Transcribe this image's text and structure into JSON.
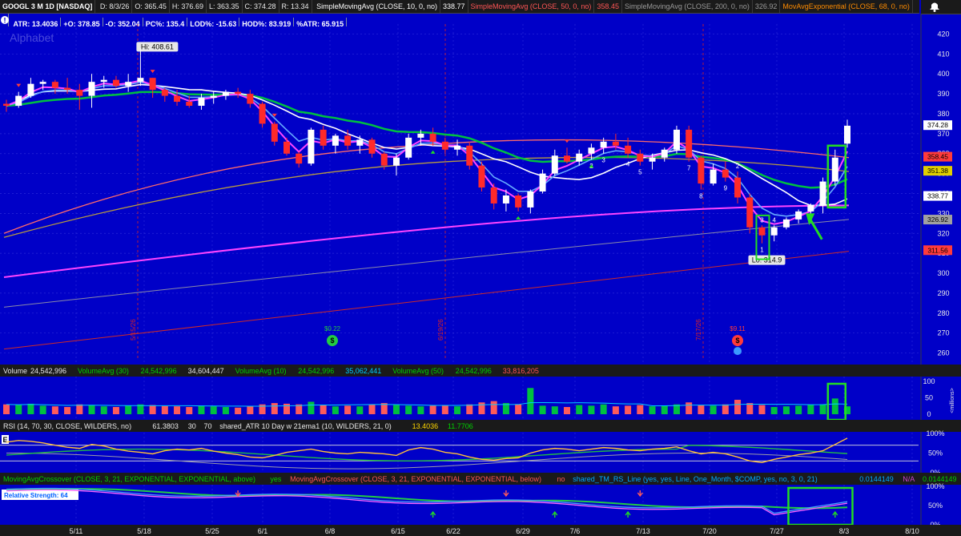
{
  "header": {
    "symbol": "GOOGL 3 M 1D [NASDAQ]",
    "ohlc": [
      {
        "label": "D: 8/3/26",
        "color": "#e8e8e8"
      },
      {
        "label": "O: 365.45",
        "color": "#e8e8e8"
      },
      {
        "label": "H: 376.69",
        "color": "#e8e8e8"
      },
      {
        "label": "L: 363.35",
        "color": "#e8e8e8"
      },
      {
        "label": "C: 374.28",
        "color": "#e8e8e8"
      },
      {
        "label": "R: 13.34",
        "color": "#e8e8e8"
      }
    ],
    "studies": [
      {
        "label": "SimpleMovingAvg (CLOSE, 10, 0, no)",
        "value": "338.77",
        "color": "#ffffff"
      },
      {
        "label": "SimpleMovingAvg (CLOSE, 50, 0, no)",
        "value": "358.45",
        "color": "#ff5555"
      },
      {
        "label": "SimpleMovingAvg (CLOSE, 200, 0, no)",
        "value": "326.92",
        "color": "#9a9a9a"
      },
      {
        "label": "MovAvgExponential (CLOSE, 68, 0, no)",
        "value": "",
        "color": "#ff8c00"
      }
    ],
    "info_icon": "!",
    "stats": [
      "ATR: 13.4036",
      "+O: 378.85",
      "-O: 352.04",
      "PC%: 135.4",
      "LOD%: -15.63",
      "HOD%: 83.919",
      "%ATR: 65.915"
    ],
    "watermark": "Alphabet",
    "bell_icon": "bell-icon"
  },
  "price_axis": {
    "ticks": [
      420,
      410,
      400,
      390,
      380,
      370,
      360,
      350,
      340,
      330,
      320,
      310,
      300,
      290,
      280,
      270,
      260
    ],
    "markers": [
      {
        "value": "374.28",
        "price": 374.28,
        "bg": "#ffffff",
        "fg": "#000000"
      },
      {
        "value": "358.45",
        "price": 358.45,
        "bg": "#ff3b3b",
        "fg": "#000000"
      },
      {
        "value": "351.38",
        "price": 351.38,
        "bg": "#e0d000",
        "fg": "#000000"
      },
      {
        "value": "338.77",
        "price": 338.77,
        "bg": "#ffffff",
        "fg": "#000000"
      },
      {
        "value": "326.92",
        "price": 326.92,
        "bg": "#a0a0a0",
        "fg": "#000000"
      },
      {
        "value": "311.56",
        "price": 311.56,
        "bg": "#ff3b3b",
        "fg": "#000000"
      }
    ]
  },
  "annotations": {
    "hi": "Hi: 408.61",
    "lo": "Lo: 314.9",
    "div1_value": "$0.22",
    "div2_value": "$9.11",
    "earnings_date_1": "5/15/26",
    "earnings_date_2": "6/19/26",
    "earnings_date_3": "7/17/26",
    "counts": [
      {
        "t": "1",
        "i": 62
      },
      {
        "t": "2",
        "i": 48
      },
      {
        "t": "3",
        "i": 49
      },
      {
        "t": "4",
        "i": 51
      },
      {
        "t": "5",
        "i": 52
      },
      {
        "t": "7",
        "i": 56
      },
      {
        "t": "8",
        "i": 57
      },
      {
        "t": "9",
        "i": 59
      },
      {
        "t": "2",
        "i": 60
      },
      {
        "t": "3",
        "i": 62
      },
      {
        "t": "4",
        "i": 63
      }
    ]
  },
  "volume_bar": {
    "title": "Volume",
    "items": [
      {
        "label": "24,542,996",
        "color": "#e8e8e8"
      },
      {
        "label": "VolumeAvg (30)",
        "color": "#00d000"
      },
      {
        "label": "24,542,996",
        "color": "#00d000"
      },
      {
        "label": "34,604,447",
        "color": "#e8e8e8"
      },
      {
        "label": "VolumeAvg (10)",
        "color": "#00d000"
      },
      {
        "label": "24,542,996",
        "color": "#00d000"
      },
      {
        "label": "35,062,441",
        "color": "#00ccff"
      },
      {
        "label": "VolumeAvg (50)",
        "color": "#00d000"
      },
      {
        "label": "24,542,996",
        "color": "#00d000"
      },
      {
        "label": "33,816,205",
        "color": "#ff5555"
      }
    ],
    "ticks": [
      "100",
      "50",
      "0"
    ],
    "units": "<millions>"
  },
  "rsi_bar": {
    "items": [
      {
        "label": "RSI (14, 70, 30, CLOSE, WILDERS, no)",
        "color": "#e8e8e8"
      },
      {
        "label": "61.3803",
        "color": "#e8e8e8"
      },
      {
        "label": "30",
        "color": "#e8e8e8"
      },
      {
        "label": "70",
        "color": "#e8e8e8"
      },
      {
        "label": "shared_ATR 10 Day w 21ema1 (10, WILDERS, 21, 0)",
        "color": "#e8e8e8"
      },
      {
        "label": "13.4036",
        "color": "#ffd700"
      },
      {
        "label": "11.7706",
        "color": "#00d000"
      }
    ],
    "badge": "E",
    "ticks": [
      "100%",
      "50%",
      "0%"
    ]
  },
  "rs_bar": {
    "items": [
      {
        "label": "MovingAvgCrossover (CLOSE, 3, 21, EXPONENTIAL, EXPONENTIAL, above)",
        "color": "#00d000"
      },
      {
        "label": "yes",
        "color": "#00d000"
      },
      {
        "label": "MovingAvgCrossover (CLOSE, 3, 21, EXPONENTIAL, EXPONENTIAL, below)",
        "color": "#ff5555"
      },
      {
        "label": "no",
        "color": "#ff5555"
      },
      {
        "label": "shared_TM_RS_Line (yes, yes, Line, One_Month, $COMP, yes, no, 3, 0, 21)",
        "color": "#00aaff"
      },
      {
        "label": "0.0144149",
        "color": "#00aaff"
      },
      {
        "label": "N/A",
        "color": "#cc44cc"
      },
      {
        "label": "0.0144149",
        "color": "#00d000"
      }
    ],
    "label": "Relative Strength: 64",
    "ticks": [
      "100%",
      "50%",
      "0%"
    ]
  },
  "time_axis": {
    "labels": [
      "5/11",
      "5/18",
      "5/25",
      "6/1",
      "6/8",
      "6/15",
      "6/22",
      "6/29",
      "7/6",
      "7/13",
      "7/20",
      "7/27",
      "8/3",
      "8/10"
    ]
  },
  "colors": {
    "background": "#0000c8",
    "up_candle": "#ffffff",
    "down_candle": "#ff2a2a",
    "sma10": "#ffffff",
    "sma50": "#ff5555",
    "sma200": "#a0a0a0",
    "ema68": "#ff8c00",
    "ema21": "#00c040",
    "magenta_ma": "#ff44ff",
    "highlight": "#22dd22"
  },
  "chart_data": {
    "type": "candlestick",
    "symbol": "GOOGL",
    "x_unit": "trading day",
    "ylim": [
      255,
      425
    ],
    "candles": [
      [
        385,
        387,
        381,
        384
      ],
      [
        384,
        391,
        383,
        389
      ],
      [
        389,
        398,
        388,
        395
      ],
      [
        395,
        397,
        392,
        396
      ],
      [
        396,
        397,
        390,
        393
      ],
      [
        393,
        398,
        390,
        392
      ],
      [
        392,
        395,
        382,
        389
      ],
      [
        389,
        400,
        383,
        396
      ],
      [
        396,
        399,
        393,
        397
      ],
      [
        397,
        399,
        393,
        394
      ],
      [
        394,
        400,
        391,
        396
      ],
      [
        396,
        409,
        394,
        398
      ],
      [
        398,
        398,
        388,
        392
      ],
      [
        392,
        393,
        386,
        389
      ],
      [
        389,
        392,
        384,
        386
      ],
      [
        386,
        389,
        383,
        384
      ],
      [
        384,
        390,
        382,
        388
      ],
      [
        388,
        391,
        385,
        389
      ],
      [
        389,
        392,
        387,
        391
      ],
      [
        391,
        393,
        388,
        390
      ],
      [
        390,
        392,
        383,
        385
      ],
      [
        385,
        386,
        373,
        375
      ],
      [
        375,
        376,
        364,
        366
      ],
      [
        366,
        368,
        359,
        360
      ],
      [
        360,
        361,
        353,
        355
      ],
      [
        355,
        373,
        354,
        372
      ],
      [
        372,
        374,
        362,
        364
      ],
      [
        364,
        370,
        360,
        369
      ],
      [
        369,
        372,
        362,
        364
      ],
      [
        364,
        369,
        360,
        367
      ],
      [
        367,
        368,
        358,
        360
      ],
      [
        360,
        361,
        352,
        354
      ],
      [
        354,
        360,
        349,
        358
      ],
      [
        358,
        370,
        357,
        368
      ],
      [
        368,
        372,
        364,
        370
      ],
      [
        370,
        373,
        364,
        366
      ],
      [
        366,
        368,
        360,
        362
      ],
      [
        362,
        367,
        359,
        364
      ],
      [
        364,
        366,
        352,
        354
      ],
      [
        354,
        356,
        341,
        343
      ],
      [
        343,
        345,
        332,
        335
      ],
      [
        335,
        342,
        331,
        339
      ],
      [
        339,
        340,
        331,
        333
      ],
      [
        333,
        342,
        330,
        341
      ],
      [
        341,
        352,
        340,
        350
      ],
      [
        350,
        362,
        349,
        359
      ],
      [
        359,
        363,
        355,
        356
      ],
      [
        356,
        362,
        354,
        360
      ],
      [
        360,
        365,
        357,
        363
      ],
      [
        363,
        368,
        360,
        366
      ],
      [
        366,
        370,
        362,
        364
      ],
      [
        364,
        368,
        358,
        360
      ],
      [
        360,
        362,
        354,
        356
      ],
      [
        356,
        360,
        352,
        358
      ],
      [
        358,
        363,
        356,
        362
      ],
      [
        362,
        374,
        360,
        372
      ],
      [
        372,
        374,
        356,
        358
      ],
      [
        358,
        359,
        342,
        345
      ],
      [
        345,
        355,
        344,
        352
      ],
      [
        352,
        356,
        346,
        348
      ],
      [
        348,
        351,
        335,
        338
      ],
      [
        338,
        340,
        320,
        323
      ],
      [
        323,
        324,
        315,
        319
      ],
      [
        319,
        324,
        316,
        323
      ],
      [
        323,
        328,
        322,
        327
      ],
      [
        327,
        332,
        325,
        331
      ],
      [
        331,
        335,
        329,
        334
      ],
      [
        334,
        348,
        330,
        346
      ],
      [
        346,
        362,
        344,
        358
      ],
      [
        365,
        377,
        363,
        374
      ]
    ],
    "volume_millions": [
      30,
      28,
      32,
      26,
      24,
      22,
      30,
      28,
      24,
      22,
      26,
      30,
      28,
      25,
      24,
      22,
      26,
      24,
      22,
      20,
      24,
      30,
      34,
      32,
      30,
      38,
      28,
      24,
      26,
      24,
      30,
      34,
      28,
      26,
      24,
      26,
      28,
      24,
      30,
      36,
      40,
      34,
      30,
      80,
      26,
      24,
      22,
      28,
      26,
      30,
      24,
      26,
      28,
      24,
      26,
      30,
      36,
      28,
      26,
      30,
      44,
      34,
      28,
      22,
      24,
      26,
      28,
      30,
      48,
      24
    ],
    "rsi": {
      "ylim": [
        0,
        100
      ]
    },
    "relative_strength": {
      "ylim": [
        0,
        100
      ],
      "value": 64
    }
  }
}
